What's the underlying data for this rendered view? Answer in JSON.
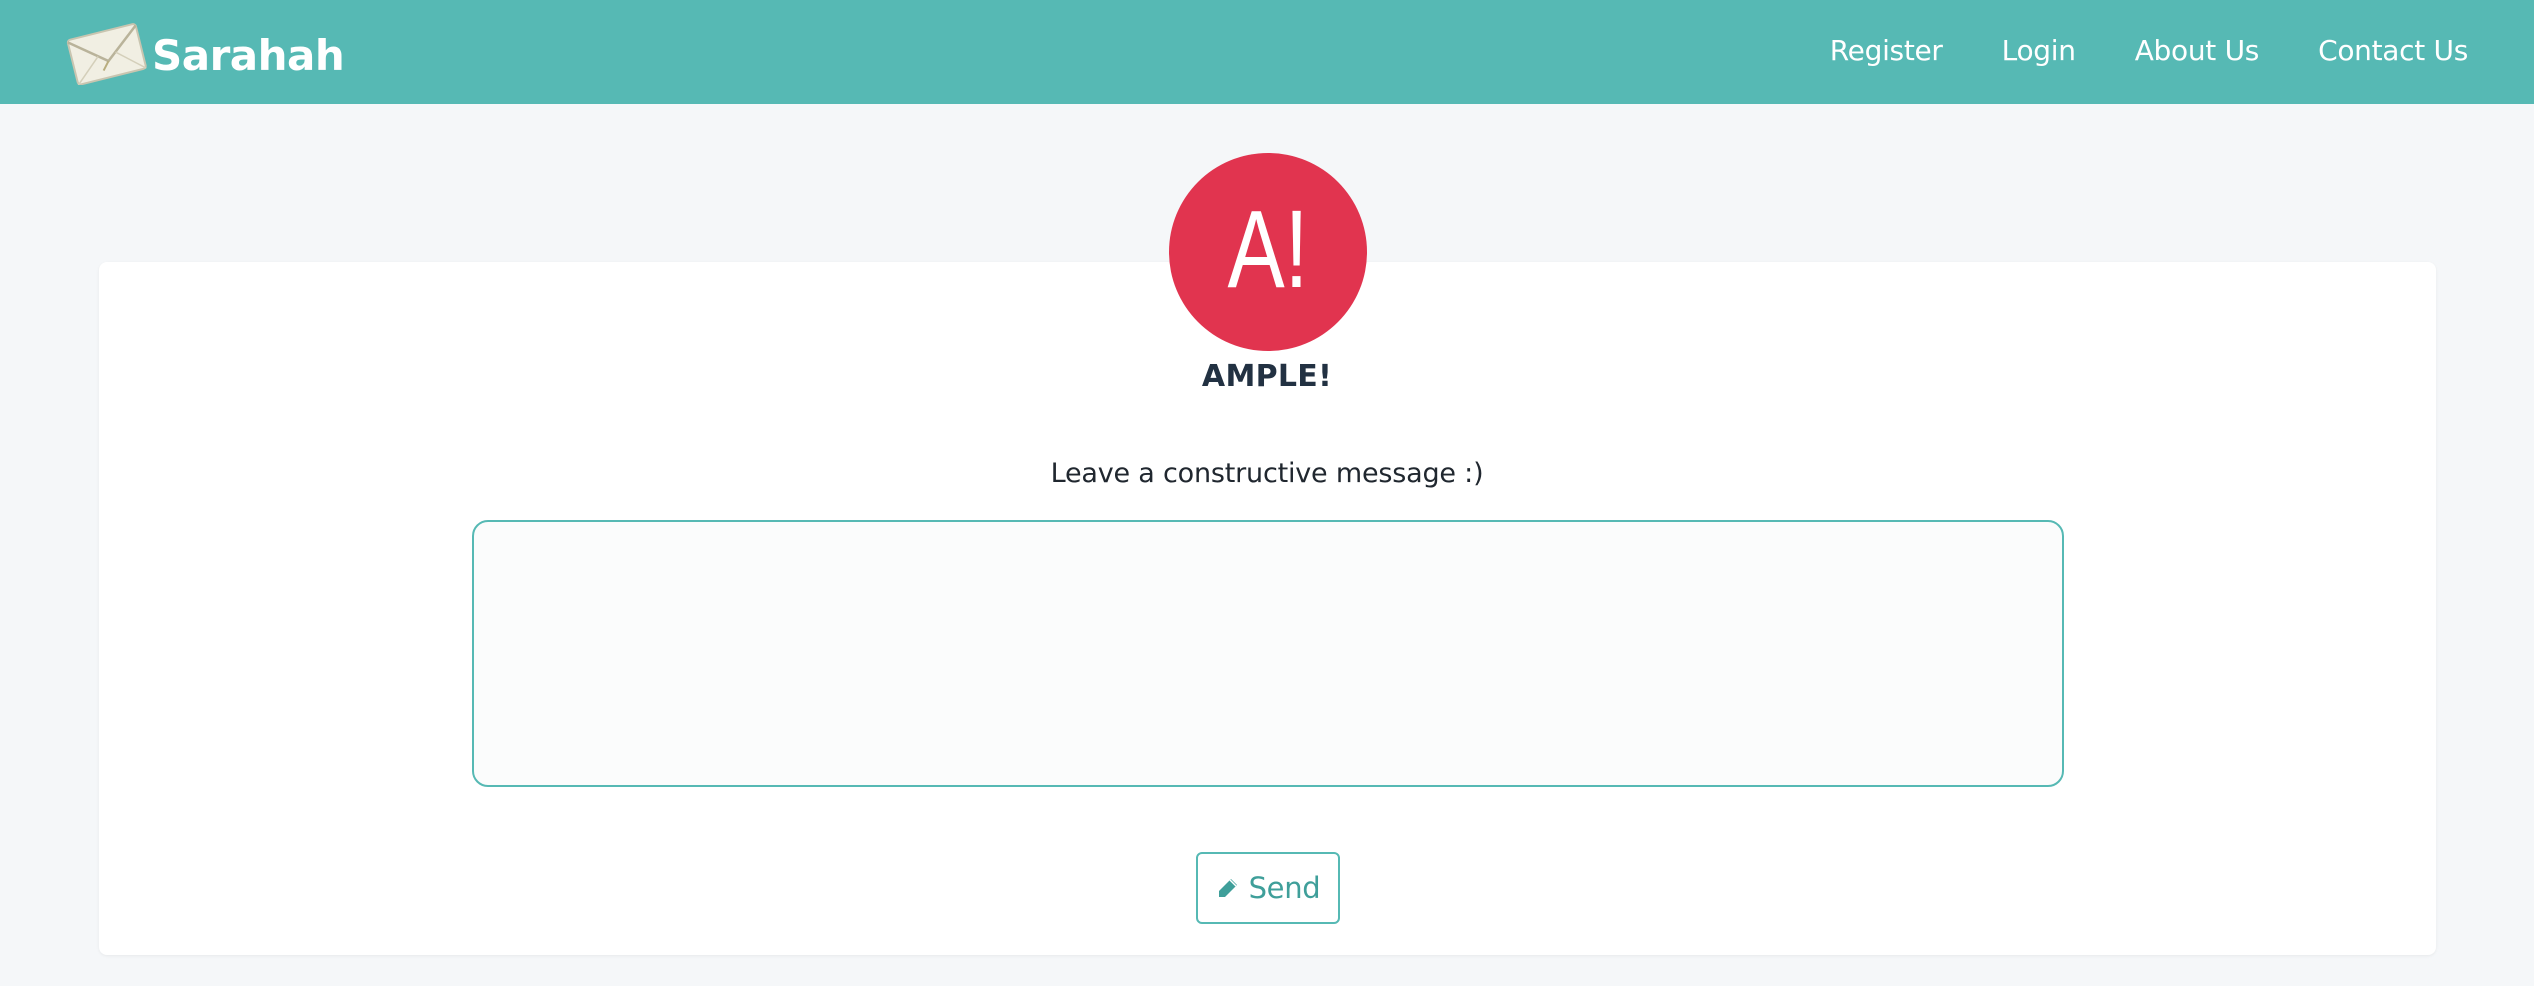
{
  "brand": {
    "name": "Sarahah",
    "icon": "envelope-icon"
  },
  "nav": {
    "items": [
      {
        "label": "Register"
      },
      {
        "label": "Login"
      },
      {
        "label": "About Us"
      },
      {
        "label": "Contact Us"
      }
    ]
  },
  "profile": {
    "avatar_text": "A!",
    "name": "AMPLE!"
  },
  "message": {
    "prompt": "Leave a constructive message :)",
    "value": "",
    "placeholder": ""
  },
  "send": {
    "label": "Send",
    "icon": "pencil-icon"
  },
  "colors": {
    "navbar": "#56b9b4",
    "avatar": "#e1344f",
    "background": "#f5f7f9",
    "accent": "#56b9b4",
    "send_text": "#3f9f9a"
  }
}
